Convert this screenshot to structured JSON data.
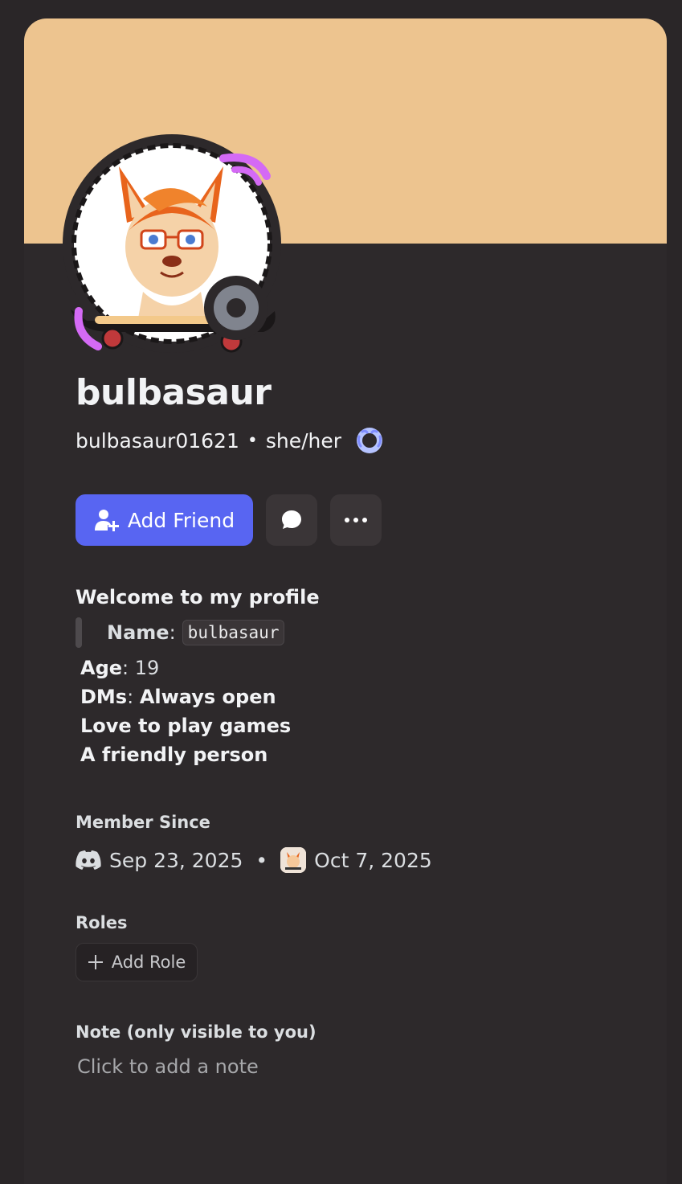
{
  "profile": {
    "display_name": "bulbasaur",
    "username": "bulbasaur01621",
    "separator": "•",
    "pronouns": "she/her",
    "banner_color": "#edc48f",
    "status_color": "#80848e",
    "badge_icon": "laurel-badge-icon"
  },
  "actions": {
    "add_friend_label": "Add Friend",
    "message_icon": "chat-bubble-icon",
    "more_icon": "more-dots-icon",
    "accent_color": "#5865f2"
  },
  "bio": {
    "title": "Welcome to my profile",
    "name_label": "Name",
    "name_value": "bulbasaur",
    "age_label": "Age",
    "age_value": "19",
    "dms_label": "DMs",
    "dms_value": "Always open",
    "line_games": "Love to play games",
    "line_friendly": "A friendly person"
  },
  "member_since": {
    "label": "Member Since",
    "discord_date": "Sep 23, 2025",
    "separator": "•",
    "server_date": "Oct 7, 2025"
  },
  "roles": {
    "label": "Roles",
    "add_role_label": "Add Role"
  },
  "note": {
    "label": "Note (only visible to you)",
    "placeholder": "Click to add a note"
  }
}
